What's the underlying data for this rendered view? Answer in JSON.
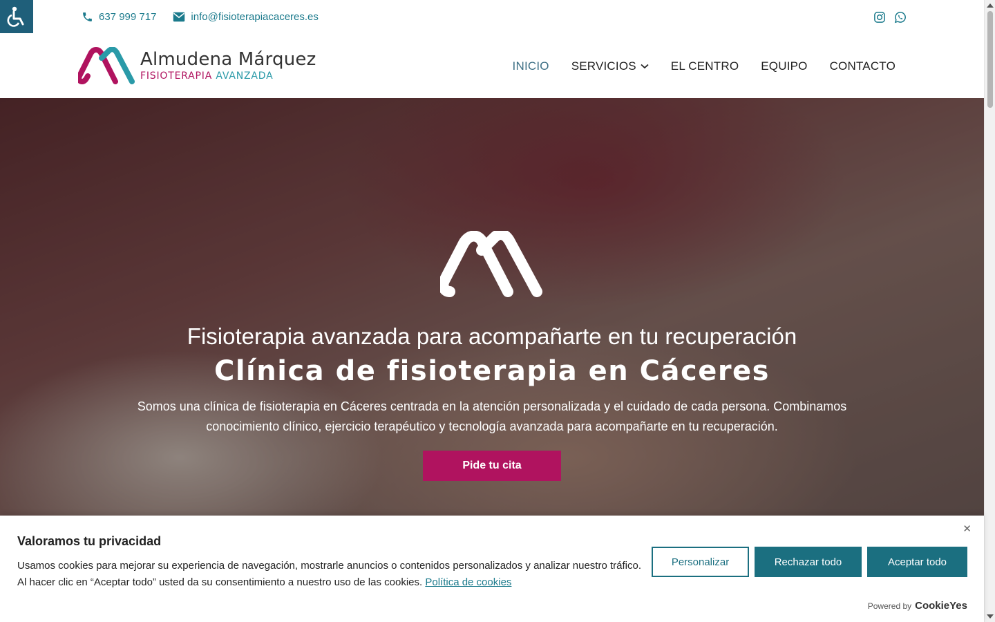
{
  "topbar": {
    "phone": "637 999 717",
    "email": "info@fisioterapiacaceres.es",
    "social": [
      "instagram-icon",
      "whatsapp-icon"
    ]
  },
  "logo": {
    "name": "Almudena Márquez",
    "sub_pink": "FISIOTERAPIA",
    "sub_teal": "AVANZADA"
  },
  "nav": {
    "items": [
      {
        "label": "INICIO",
        "active": true
      },
      {
        "label": "SERVICIOS",
        "dropdown": true
      },
      {
        "label": "EL CENTRO"
      },
      {
        "label": "EQUIPO"
      },
      {
        "label": "CONTACTO"
      }
    ]
  },
  "hero": {
    "title": "Fisioterapia avanzada para acompañarte en tu recuperación",
    "subtitle": "Clínica de fisioterapia en Cáceres",
    "text": "Somos una clínica de fisioterapia en Cáceres centrada en la atención personalizada y el cuidado de cada persona. Combinamos conocimiento clínico, ejercicio terapéutico y tecnología avanzada para acompañarte en tu recuperación.",
    "cta": "Pide tu cita"
  },
  "cookie": {
    "title": "Valoramos tu privacidad",
    "text": "Usamos cookies para mejorar su experiencia de navegación, mostrarle anuncios o contenidos personalizados y analizar nuestro tráfico. Al hacer clic en “Aceptar todo” usted da su consentimiento a nuestro uso de las cookies.",
    "policy_link": "Política de cookies",
    "btn_customize": "Personalizar",
    "btn_reject": "Rechazar todo",
    "btn_accept": "Aceptar todo",
    "powered_by": "Powered by",
    "brand": "CookieYes",
    "close": "✕"
  },
  "colors": {
    "brand_pink": "#b0135f",
    "brand_teal": "#2a9aa8",
    "button_teal": "#1b6f80",
    "a11y_bg": "#1f5f7a"
  }
}
